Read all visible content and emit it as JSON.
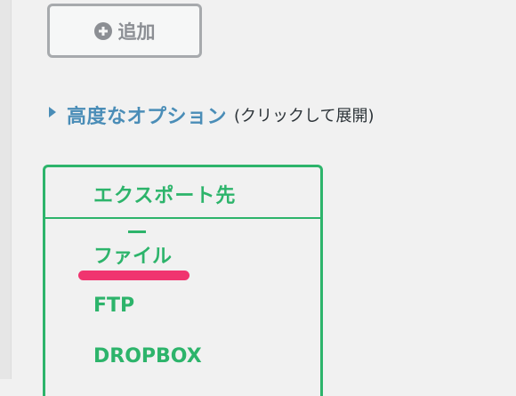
{
  "add_button": {
    "label": "追加",
    "icon": "plus-circle-icon"
  },
  "advanced_options": {
    "icon": "triangle-right-icon",
    "title": "高度なオプション",
    "hint": "(クリックして展開)"
  },
  "export_destination": {
    "title": "エクスポート先",
    "options": [
      {
        "label": "ファイル",
        "selected": true
      },
      {
        "label": "FTP",
        "selected": false
      },
      {
        "label": "DROPBOX",
        "selected": false
      }
    ]
  },
  "colors": {
    "accent_green": "#2db46b",
    "link_blue": "#4a8db7",
    "highlight_pink": "#f0346f",
    "button_gray": "#a7aaad"
  }
}
